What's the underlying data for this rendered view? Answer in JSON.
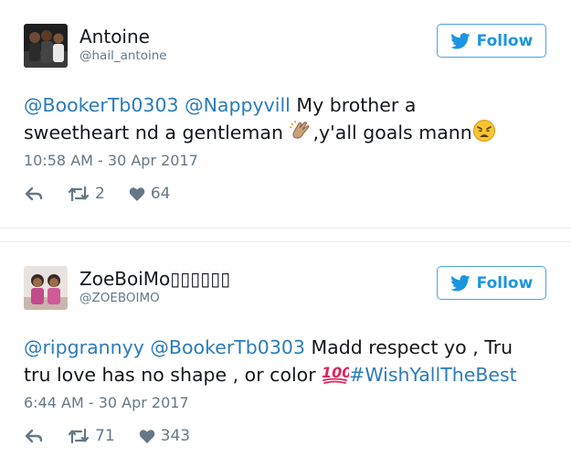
{
  "tweets": [
    {
      "display_name": "Antoine",
      "screen_name": "@hail_antoine",
      "follow_label": "Follow",
      "text": {
        "mention1": "@BookerTb0303",
        "mention2": "@Nappyvill",
        "part1": " My brother a",
        "part2": "sweetheart nd a gentleman ",
        "part3": ",y'all goals mann"
      },
      "timestamp": "10:58 AM - 30 Apr 2017",
      "retweets": "2",
      "likes": "64"
    },
    {
      "display_name": "ZoeBoiMo▯▯▯▯▯▯",
      "screen_name": "@ZOEBOIMO",
      "follow_label": "Follow",
      "text": {
        "mention1": "@ripgrannyy",
        "mention2": "@BookerTb0303",
        "part1": " Madd respect yo , Tru",
        "part2": "tru love has no shape , or color ",
        "hashtag": "#WishYallTheBest"
      },
      "timestamp": "6:44 AM - 30 Apr 2017",
      "retweets": "71",
      "likes": "343"
    }
  ],
  "colors": {
    "link": "#2b7bb9",
    "twitter_blue": "#1b95e0",
    "muted": "#657786"
  }
}
